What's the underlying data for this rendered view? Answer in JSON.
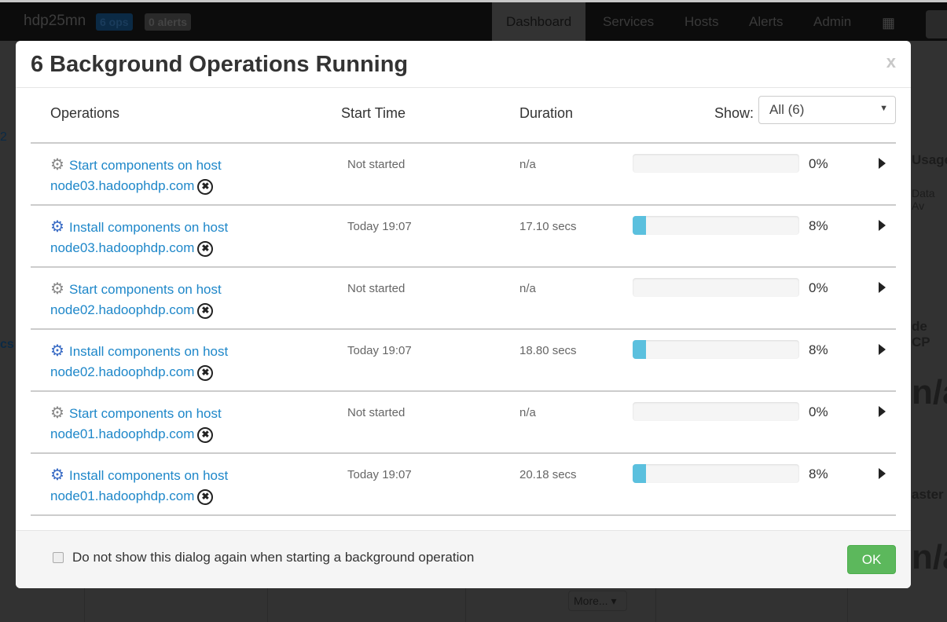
{
  "topbar": {
    "cluster": "hdp25mn",
    "ops_badge": "6 ops",
    "alerts_badge": "0 alerts",
    "nav": [
      "Dashboard",
      "Services",
      "Hosts",
      "Alerts",
      "Admin"
    ],
    "active": "Dashboard"
  },
  "background": {
    "texts": [
      "Usage",
      "Data Av",
      "de CP",
      "n/a",
      "aster",
      "n/a",
      "2",
      "cs"
    ],
    "more_label": "More..."
  },
  "modal": {
    "title": "6 Background Operations Running",
    "close": "x",
    "columns": {
      "operations": "Operations",
      "start": "Start Time",
      "duration": "Duration",
      "show_label": "Show:"
    },
    "filter": {
      "selected": "All (6)"
    },
    "rows": [
      {
        "icon": "gear-icon",
        "name": "Start components on host",
        "host": "node03.hadoophdp.com",
        "start": "Not started",
        "duration": "n/a",
        "progress": 0,
        "pct": "0%"
      },
      {
        "icon": "gears-icon",
        "name": "Install components on host",
        "host": "node03.hadoophdp.com",
        "start": "Today 19:07",
        "duration": "17.10 secs",
        "progress": 8,
        "pct": "8%"
      },
      {
        "icon": "gear-icon",
        "name": "Start components on host",
        "host": "node02.hadoophdp.com",
        "start": "Not started",
        "duration": "n/a",
        "progress": 0,
        "pct": "0%"
      },
      {
        "icon": "gears-icon",
        "name": "Install components on host",
        "host": "node02.hadoophdp.com",
        "start": "Today 19:07",
        "duration": "18.80 secs",
        "progress": 8,
        "pct": "8%"
      },
      {
        "icon": "gear-icon",
        "name": "Start components on host",
        "host": "node01.hadoophdp.com",
        "start": "Not started",
        "duration": "n/a",
        "progress": 0,
        "pct": "0%"
      },
      {
        "icon": "gears-icon",
        "name": "Install components on host",
        "host": "node01.hadoophdp.com",
        "start": "Today 19:07",
        "duration": "20.18 secs",
        "progress": 8,
        "pct": "8%"
      }
    ],
    "footer": {
      "checkbox_label": "Do not show this dialog again when starting a background operation",
      "checked": false,
      "ok": "OK"
    },
    "colors": {
      "link": "#1e87c9",
      "progress": "#5bc0de",
      "ok": "#5cb85c"
    }
  }
}
